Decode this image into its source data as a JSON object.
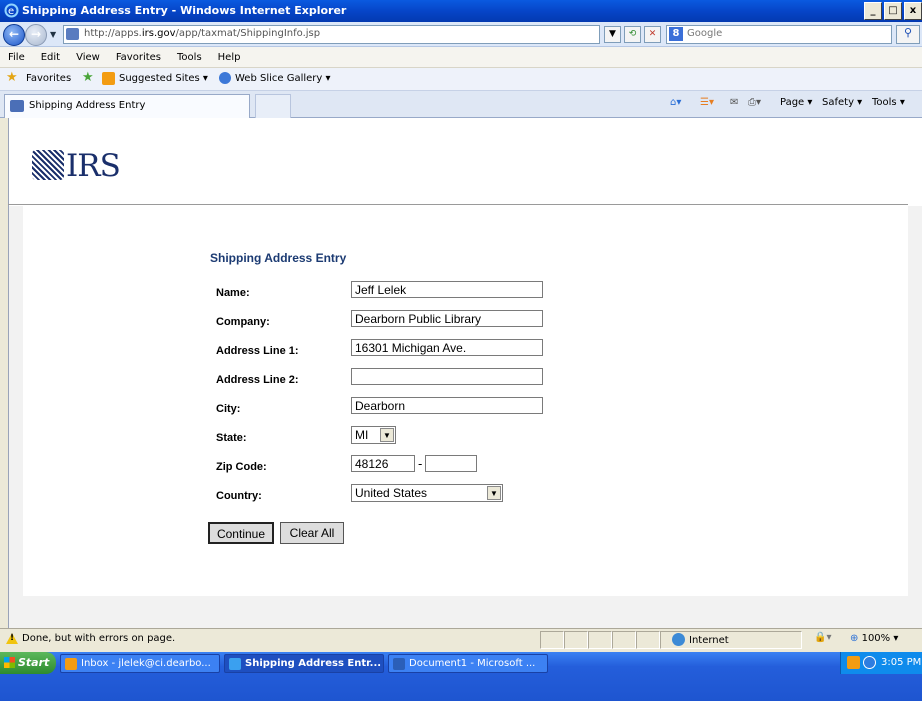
{
  "window": {
    "title": "Shipping Address Entry - Windows Internet Explorer",
    "minimize": "_",
    "restore": "□",
    "close": "x"
  },
  "address_bar": {
    "url_prefix": "http://apps.",
    "url_domain": "irs.gov",
    "url_suffix": "/app/taxmat/ShippingInfo.jsp",
    "search_placeholder": "Google"
  },
  "menu": [
    "File",
    "Edit",
    "View",
    "Favorites",
    "Tools",
    "Help"
  ],
  "favorites_bar": {
    "favorites": "Favorites",
    "suggested": "Suggested Sites ▾",
    "web_slice": "Web Slice Gallery ▾"
  },
  "tab": {
    "label": "Shipping Address Entry"
  },
  "command_bar": {
    "page": "Page ▾",
    "safety": "Safety ▾",
    "tools": "Tools ▾"
  },
  "page": {
    "logo_text": "IRS",
    "form_title": "Shipping Address Entry",
    "fields": {
      "name": {
        "label": "Name:",
        "value": "Jeff Lelek"
      },
      "company": {
        "label": "Company:",
        "value": "Dearborn Public Library"
      },
      "address1": {
        "label": "Address Line 1:",
        "value": "16301 Michigan Ave."
      },
      "address2": {
        "label": "Address Line 2:",
        "value": ""
      },
      "city": {
        "label": "City:",
        "value": "Dearborn"
      },
      "state": {
        "label": "State:",
        "value": "MI"
      },
      "zip": {
        "label": "Zip Code:",
        "value": "48126",
        "ext": "",
        "dash": "-"
      },
      "country": {
        "label": "Country:",
        "value": "United States"
      }
    },
    "buttons": {
      "continue": "Continue",
      "clear": "Clear All"
    }
  },
  "status_bar": {
    "message": "Done, but with errors on page.",
    "zone": "Internet",
    "zoom": "100%"
  },
  "taskbar": {
    "start": "Start",
    "items": [
      "Inbox - jlelek@ci.dearbo...",
      "Shipping Address Entr...",
      "Document1 - Microsoft ..."
    ],
    "clock": "3:05 PM"
  },
  "colors": {
    "title_blue": "#0645c8",
    "form_title": "#1b3a72",
    "irs_blue": "#1a2f6b"
  }
}
